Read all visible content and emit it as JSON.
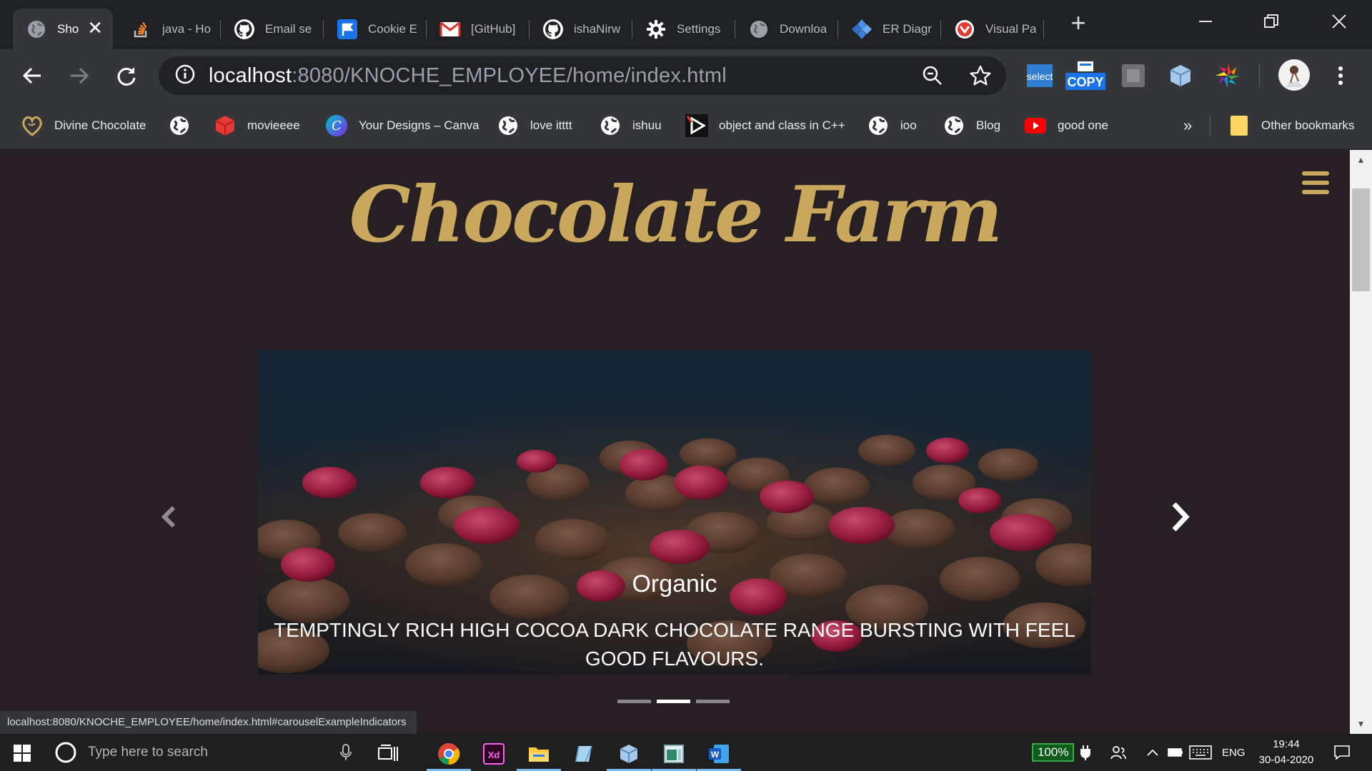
{
  "browser": {
    "tabs": [
      {
        "label": "Sho",
        "icon": "globe-icon",
        "active": true
      },
      {
        "label": "java - Ho",
        "icon": "stackoverflow-icon"
      },
      {
        "label": "Email se",
        "icon": "github-icon"
      },
      {
        "label": "Cookie E",
        "icon": "flag-icon"
      },
      {
        "label": "[GitHub]",
        "icon": "gmail-icon"
      },
      {
        "label": "ishaNirw",
        "icon": "github-icon"
      },
      {
        "label": "Settings",
        "icon": "gear-icon"
      },
      {
        "label": "Downloa",
        "icon": "globe-icon"
      },
      {
        "label": "ER Diagr",
        "icon": "diagram-icon"
      },
      {
        "label": "Visual Pa",
        "icon": "visual-paradigm-icon"
      }
    ],
    "url_host": "localhost",
    "url_path": ":8080/KNOCHE_EMPLOYEE/home/index.html",
    "bookmarks": [
      {
        "label": "Divine Chocolate",
        "icon": "heart-logo-icon"
      },
      {
        "label": "",
        "icon": "globe-icon"
      },
      {
        "label": "movieeee",
        "icon": "red-cube-icon"
      },
      {
        "label": "Your Designs – Canva",
        "icon": "canva-icon"
      },
      {
        "label": "love itttt",
        "icon": "globe-icon"
      },
      {
        "label": "ishuu",
        "icon": "globe-icon"
      },
      {
        "label": "object and class in C++",
        "icon": "play-icon"
      },
      {
        "label": "ioo",
        "icon": "globe-icon"
      },
      {
        "label": "Blog",
        "icon": "globe-icon"
      },
      {
        "label": "good one",
        "icon": "youtube-icon"
      }
    ],
    "bookmarks_overflow": "»",
    "other_bookmarks": "Other bookmarks",
    "extensions": {
      "select": "select",
      "copy": "COPY"
    },
    "status_url": "localhost:8080/KNOCHE_EMPLOYEE/home/index.html#carouselExampleIndicators"
  },
  "page": {
    "brand": "Chocolate Farm",
    "carousel": {
      "title": "Organic",
      "text": "TEMPTINGLY RICH HIGH COCOA DARK CHOCOLATE RANGE BURSTING WITH FEEL GOOD FLAVOURS.",
      "indicator_count": 3,
      "active_indicator": 2
    }
  },
  "taskbar": {
    "search_placeholder": "Type here to search",
    "battery": "100%",
    "language": "ENG",
    "time": "19:44",
    "date": "30-04-2020"
  },
  "colors": {
    "brand_gold": "#c9a85d",
    "page_bg": "#261f24",
    "chrome_dark": "#202124",
    "chrome_mid": "#35363a"
  }
}
